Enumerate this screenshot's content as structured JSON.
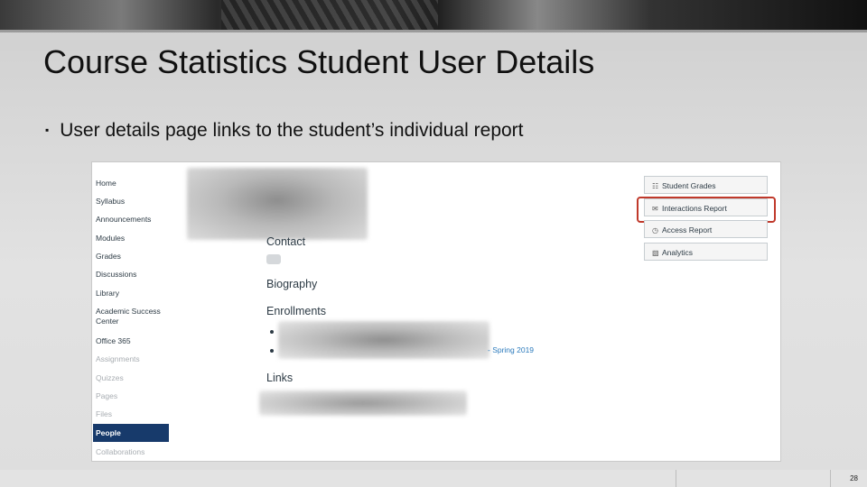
{
  "slide": {
    "title": "Course Statistics Student User Details",
    "bullet": "User details page links to the student’s individual report",
    "page_number": "28"
  },
  "course_nav": [
    {
      "label": "Home",
      "state": "normal"
    },
    {
      "label": "Syllabus",
      "state": "normal"
    },
    {
      "label": "Announcements",
      "state": "normal"
    },
    {
      "label": "Modules",
      "state": "normal"
    },
    {
      "label": "Grades",
      "state": "normal"
    },
    {
      "label": "Discussions",
      "state": "normal"
    },
    {
      "label": "Library",
      "state": "normal"
    },
    {
      "label": "Academic Success Center",
      "state": "normal"
    },
    {
      "label": "Office 365",
      "state": "normal"
    },
    {
      "label": "Assignments",
      "state": "disabled"
    },
    {
      "label": "Quizzes",
      "state": "disabled"
    },
    {
      "label": "Pages",
      "state": "disabled"
    },
    {
      "label": "Files",
      "state": "disabled"
    },
    {
      "label": "People",
      "state": "active"
    },
    {
      "label": "Collaborations",
      "state": "disabled"
    }
  ],
  "profile": {
    "contact_heading": "Contact",
    "biography_heading": "Biography",
    "enrollments_heading": "Enrollments",
    "enrollment_suffix": "- Spring 2019",
    "links_heading": "Links"
  },
  "actions": [
    {
      "label": "Student Grades",
      "icon": "gradebook-icon",
      "glyph": "☷",
      "highlighted": false
    },
    {
      "label": "Interactions Report",
      "icon": "chat-icon",
      "glyph": "✉",
      "highlighted": true
    },
    {
      "label": "Access Report",
      "icon": "clock-icon",
      "glyph": "◷",
      "highlighted": false
    },
    {
      "label": "Analytics",
      "icon": "chart-icon",
      "glyph": "▧",
      "highlighted": false
    }
  ],
  "colors": {
    "active_nav": "#173a6b",
    "highlight_box": "#c0392b",
    "link": "#2b7abc"
  }
}
